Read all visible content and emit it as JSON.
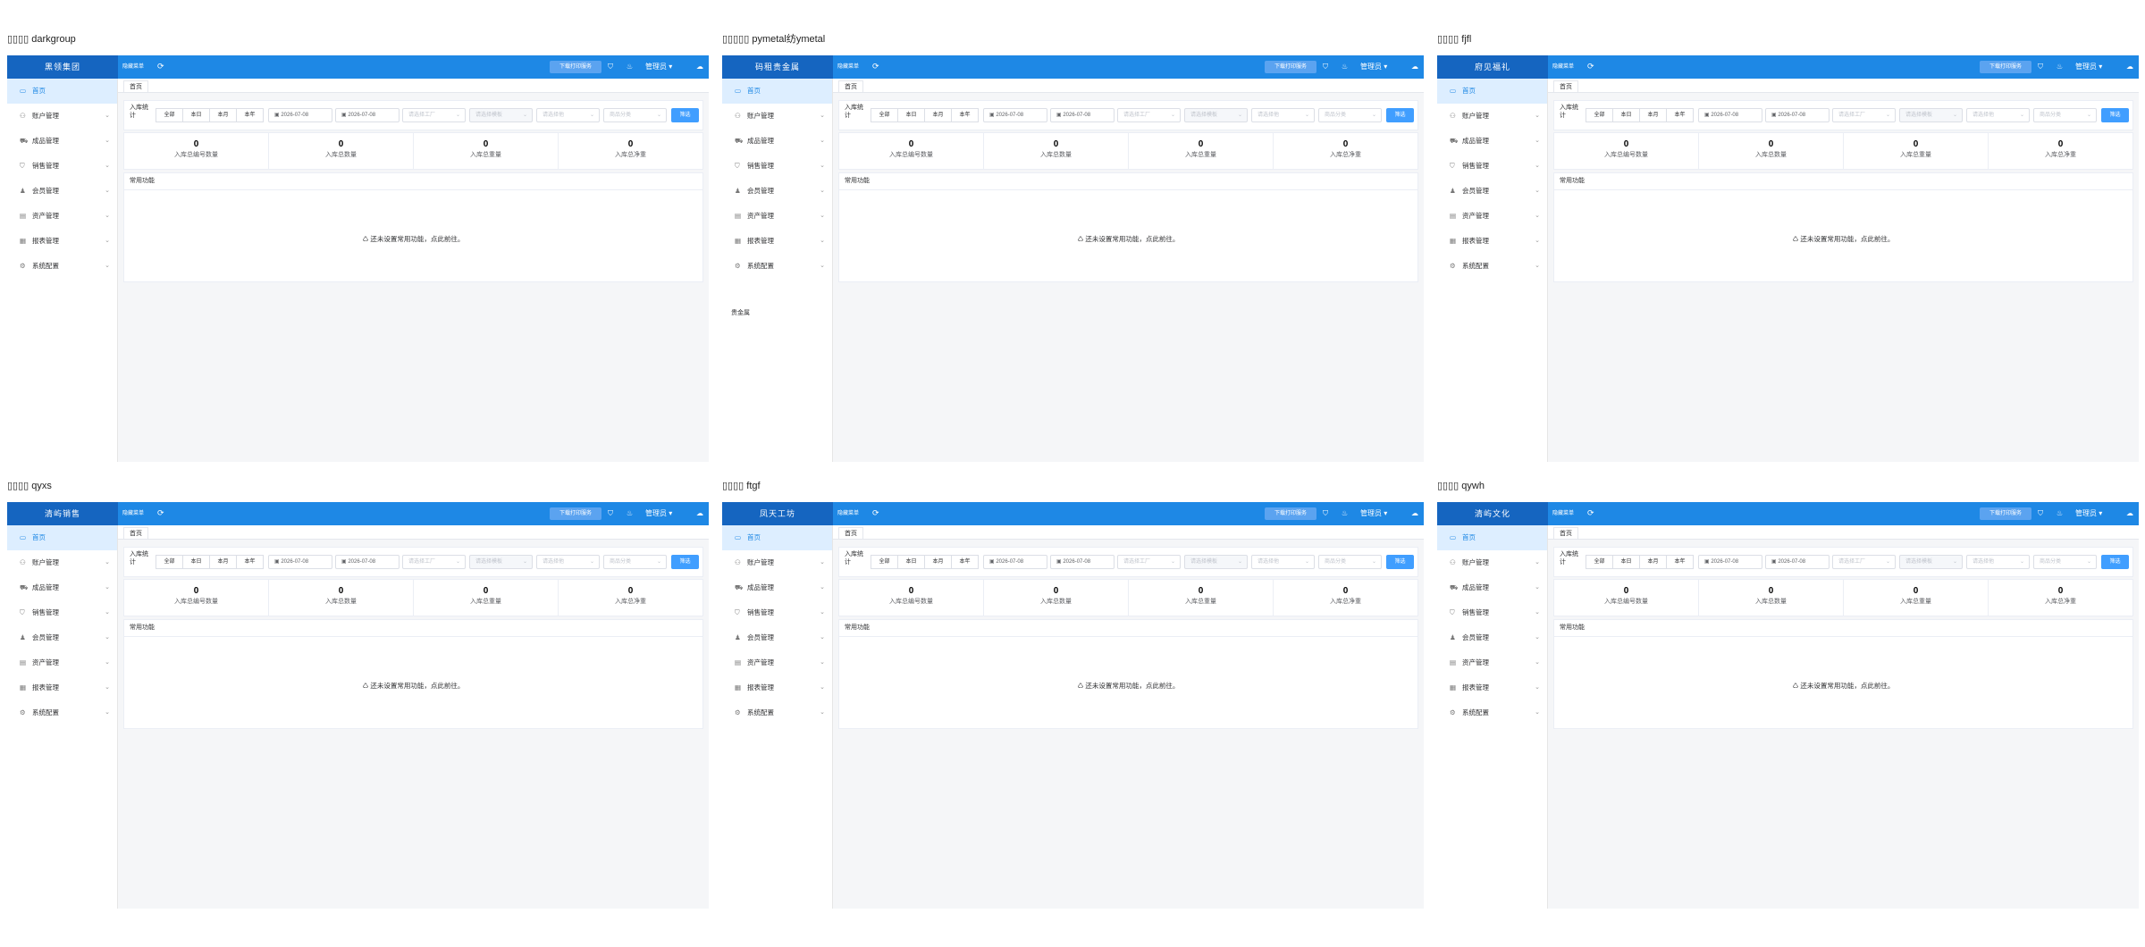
{
  "common": {
    "hide_menu": "隐藏菜单",
    "download_btn": "下载打印服务",
    "admin": "管理员",
    "admin_caret": "▾",
    "tab_home": "首页",
    "filter_title": "入库统计",
    "range_buttons": [
      "全部",
      "本日",
      "本月",
      "本年"
    ],
    "date_start": "2026-07-08",
    "date_end": "2026-07-08",
    "select_factory": "请选择工厂",
    "select_warehouse": "请选择模板",
    "select_supplier": "请选择他",
    "select_category": "商品分类",
    "filter_btn": "筛选",
    "stats": [
      {
        "value": "0",
        "label": "入库总编号数量"
      },
      {
        "value": "0",
        "label": "入库总数量"
      },
      {
        "value": "0",
        "label": "入库总重量"
      },
      {
        "value": "0",
        "label": "入库总净重"
      }
    ],
    "common_title": "常用功能",
    "common_empty": "♺ 还未设置常用功能，点此前往。",
    "menu": [
      {
        "label": "首页",
        "icon": "monitor-icon",
        "glyph": "▭",
        "chevron": ""
      },
      {
        "label": "账户管理",
        "icon": "user-icon",
        "glyph": "⚇",
        "chevron": "⌄"
      },
      {
        "label": "成品管理",
        "icon": "cart-icon",
        "glyph": "⛟",
        "chevron": "⌄"
      },
      {
        "label": "销售管理",
        "icon": "basket-icon",
        "glyph": "⛉",
        "chevron": "⌄"
      },
      {
        "label": "会员管理",
        "icon": "member-icon",
        "glyph": "♟",
        "chevron": "⌄"
      },
      {
        "label": "资产管理",
        "icon": "box-icon",
        "glyph": "▤",
        "chevron": "⌄"
      },
      {
        "label": "报表管理",
        "icon": "report-icon",
        "glyph": "▦",
        "chevron": "⌄"
      },
      {
        "label": "系统配置",
        "icon": "settings-icon",
        "glyph": "⚙",
        "chevron": "⌄"
      }
    ]
  },
  "panels": [
    {
      "label": "▯▯▯▯ darkgroup",
      "brand": "黑领集团",
      "extra": ""
    },
    {
      "label": "▯▯▯▯▯ pymetal纺ymetal",
      "brand": "码租贵金属",
      "extra": "贵金属"
    },
    {
      "label": "▯▯▯▯ fjfl",
      "brand": "府见福礼",
      "extra": ""
    },
    {
      "label": "▯▯▯▯ qyxs",
      "brand": "清屿销售",
      "extra": ""
    },
    {
      "label": "▯▯▯▯ ftgf",
      "brand": "凤天工坊",
      "extra": ""
    },
    {
      "label": "▯▯▯▯ qywh",
      "brand": "清屿文化",
      "extra": ""
    }
  ]
}
